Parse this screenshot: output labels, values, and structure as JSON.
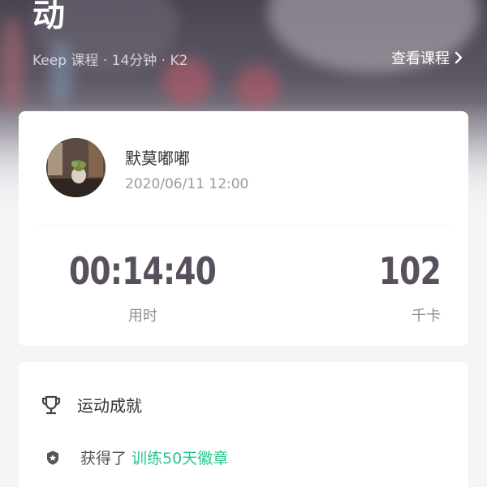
{
  "hero": {
    "title": "动",
    "course_meta": "Keep 课程 · 14分钟 · K2",
    "view_course_label": "查看课程",
    "chevron_icon": "chevron-right-icon"
  },
  "record": {
    "user_name": "默莫嘟嘟",
    "timestamp": "2020/06/11 12:00",
    "duration_value": "00:14:40",
    "duration_label": "用时",
    "calories_value": "102",
    "calories_label": "千卡"
  },
  "achievement": {
    "title": "运动成就",
    "title_icon": "trophy-icon",
    "item_icon": "badge-icon",
    "item_prefix": "获得了",
    "item_link": "训练50天徽章"
  },
  "colors": {
    "accent_green": "#24c789",
    "stat_text": "#58505c",
    "card_bg": "#ffffff",
    "page_bg": "#f5f5f7"
  }
}
